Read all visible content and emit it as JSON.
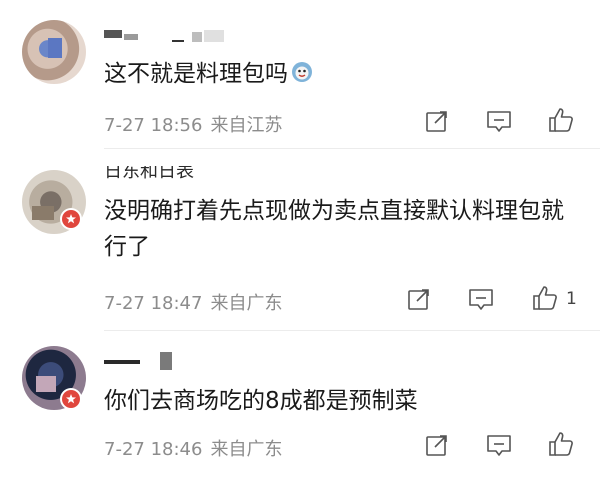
{
  "comments": [
    {
      "text": "这不就是料理包吗",
      "time": "7-27 18:56",
      "location": "来自江苏",
      "emoji": "doge-emoji"
    },
    {
      "name_fragment": "日东和日表",
      "text": "没明确打着先点现做为卖点直接默认料理包就行了",
      "time": "7-27 18:47",
      "location": "来自广东",
      "likes": "1"
    },
    {
      "text": "你们去商场吃的8成都是预制菜",
      "time": "7-27 18:46",
      "location": "来自广东"
    }
  ],
  "icons": {
    "share": "share-icon",
    "comment": "comment-icon",
    "like": "thumbs-up-icon",
    "badge": "vip-badge-icon"
  },
  "colors": {
    "badge_red": "#e0463d",
    "meta_gray": "#8c8c8c",
    "text": "#1a1a1a"
  }
}
